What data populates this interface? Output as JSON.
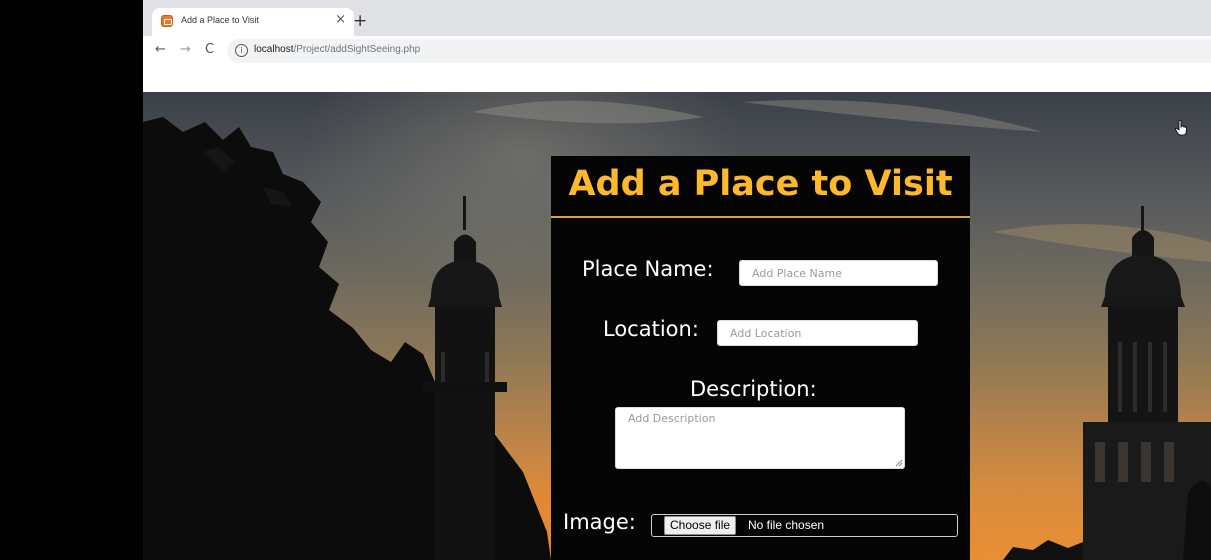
{
  "browser": {
    "tab": {
      "title": "Add a Place to Visit",
      "favicon": "browser-app-icon",
      "close_label": "×"
    },
    "new_tab_label": "+",
    "nav": {
      "back": "←",
      "forward": "→",
      "reload": "C"
    },
    "address": {
      "info_icon": "ⓘ",
      "host": "localhost",
      "path": "/Project/addSightSeeing.php"
    }
  },
  "page": {
    "title": "Add a Place to Visit",
    "title_color": "#fdb92b",
    "panel_color": "#050505",
    "form": {
      "place_name": {
        "label": "Place Name:",
        "placeholder": "Add Place Name",
        "value": ""
      },
      "location": {
        "label": "Location:",
        "placeholder": "Add Location",
        "value": ""
      },
      "description": {
        "label": "Description:",
        "placeholder": "Add Description",
        "value": ""
      },
      "image": {
        "label": "Image:",
        "button_label": "Choose file",
        "status": "No file chosen"
      }
    }
  }
}
